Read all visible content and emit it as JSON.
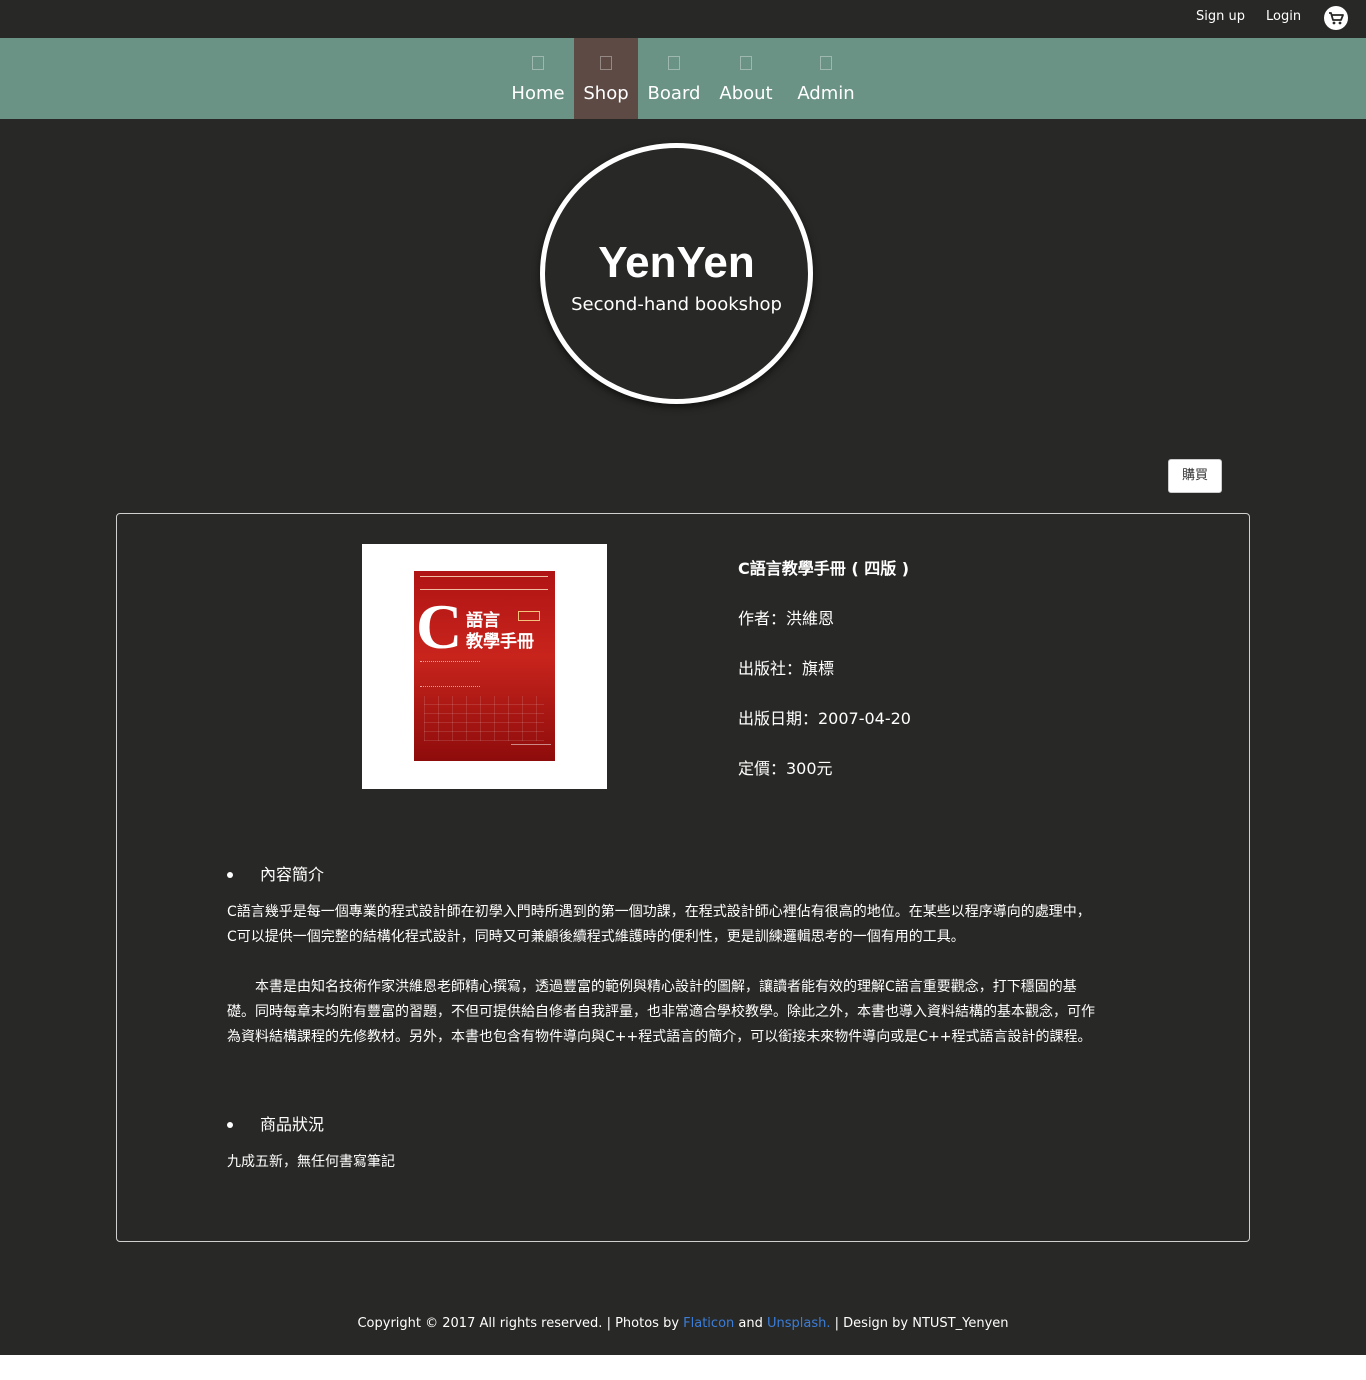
{
  "topbar": {
    "signup_label": "Sign up",
    "login_label": "Login",
    "cart_icon": "cart-icon"
  },
  "nav": {
    "items": [
      {
        "label": "Home",
        "icon": "home-icon",
        "active": false
      },
      {
        "label": "Shop",
        "icon": "shop-icon",
        "active": true
      },
      {
        "label": "Board",
        "icon": "board-icon",
        "active": false
      },
      {
        "label": "About",
        "icon": "about-icon",
        "active": false
      },
      {
        "label": "Admin",
        "icon": "admin-icon",
        "active": false
      }
    ],
    "bg_color": "#6a9385",
    "active_color": "#5d4a45"
  },
  "hero": {
    "title": "YenYen",
    "subtitle": "Second-hand bookshop"
  },
  "buy_button": {
    "label": "購買"
  },
  "product": {
    "cover_title": "語言\n教學手冊",
    "cover_letter": "C",
    "title": "C語言教學手冊 ( 四版 )",
    "author": "作者：洪維恩",
    "publisher": "出版社：旗標",
    "date": "出版日期：2007-04-20",
    "price": "定價：300元"
  },
  "description": {
    "heading": "內容簡介",
    "para1_line1": "C語言幾乎是每一個專業的程式設計師在初學入門時所遇到的第一個功課，在程式設計師心裡佔有很高的地位。在某些以程序導向的處理中，",
    "para1_line2": "C可以提供一個完整的結構化程式設計，同時又可兼顧後續程式維護時的便利性，更是訓練邏輯思考的一個有用的工具。",
    "para2_line1": "　　本書是由知名技術作家洪維恩老師精心撰寫，透過豐富的範例與精心設計的圖解，讓讀者能有效的理解C語言重要觀念，打下穩固的基",
    "para2_line2": "礎。同時每章末均附有豐富的習題，不但可提供給自修者自我評量，也非常適合學校教學。除此之外，本書也導入資料結構的基本觀念，可作",
    "para2_line3": "為資料結構課程的先修教材。另外，本書也包含有物件導向與C++程式語言的簡介，可以銜接未來物件導向或是C++程式語言設計的課程。"
  },
  "condition": {
    "heading": "商品狀況",
    "text": "九成五新，無任何書寫筆記"
  },
  "footer": {
    "prefix": "Copyright © 2017 All rights reserved. | Photos by ",
    "flaticon": "Flaticon",
    "and": " and ",
    "unsplash": "Unsplash.",
    "suffix": " | Design by NTUST_Yenyen",
    "link_color": "#3b7dd8"
  }
}
